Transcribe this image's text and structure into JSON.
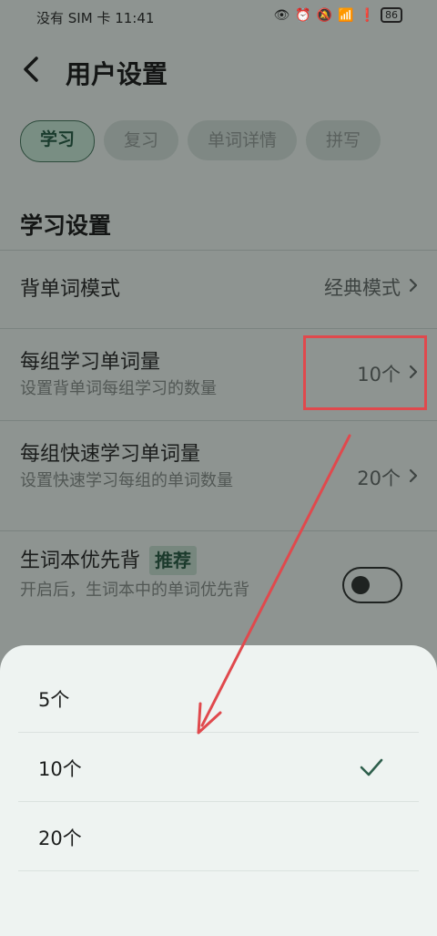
{
  "status_bar": {
    "left_text": "没有 SIM 卡 11:41",
    "battery": "86"
  },
  "header": {
    "title": "用户设置"
  },
  "tabs": [
    {
      "label": "学习",
      "active": true
    },
    {
      "label": "复习",
      "active": false
    },
    {
      "label": "单词详情",
      "active": false
    },
    {
      "label": "拼写",
      "active": false
    }
  ],
  "section": {
    "title": "学习设置"
  },
  "settings": {
    "mode": {
      "title": "背单词模式",
      "value": "经典模式"
    },
    "group_count": {
      "title": "每组学习单词量",
      "subtitle": "设置背单词每组学习的数量",
      "value": "10个"
    },
    "fast_group_count": {
      "title": "每组快速学习单词量",
      "subtitle": "设置快速学习每组的单词数量",
      "value": "20个"
    },
    "vocab_first": {
      "title": "生词本优先背",
      "badge": "推荐",
      "subtitle": "开启后，生词本中的单词优先背",
      "enabled": false
    }
  },
  "sheet": {
    "options": [
      {
        "label": "5个",
        "selected": false
      },
      {
        "label": "10个",
        "selected": true
      },
      {
        "label": "20个",
        "selected": false
      }
    ]
  },
  "colors": {
    "accent": "#2e5f4c",
    "annotation": "#e0494d"
  }
}
